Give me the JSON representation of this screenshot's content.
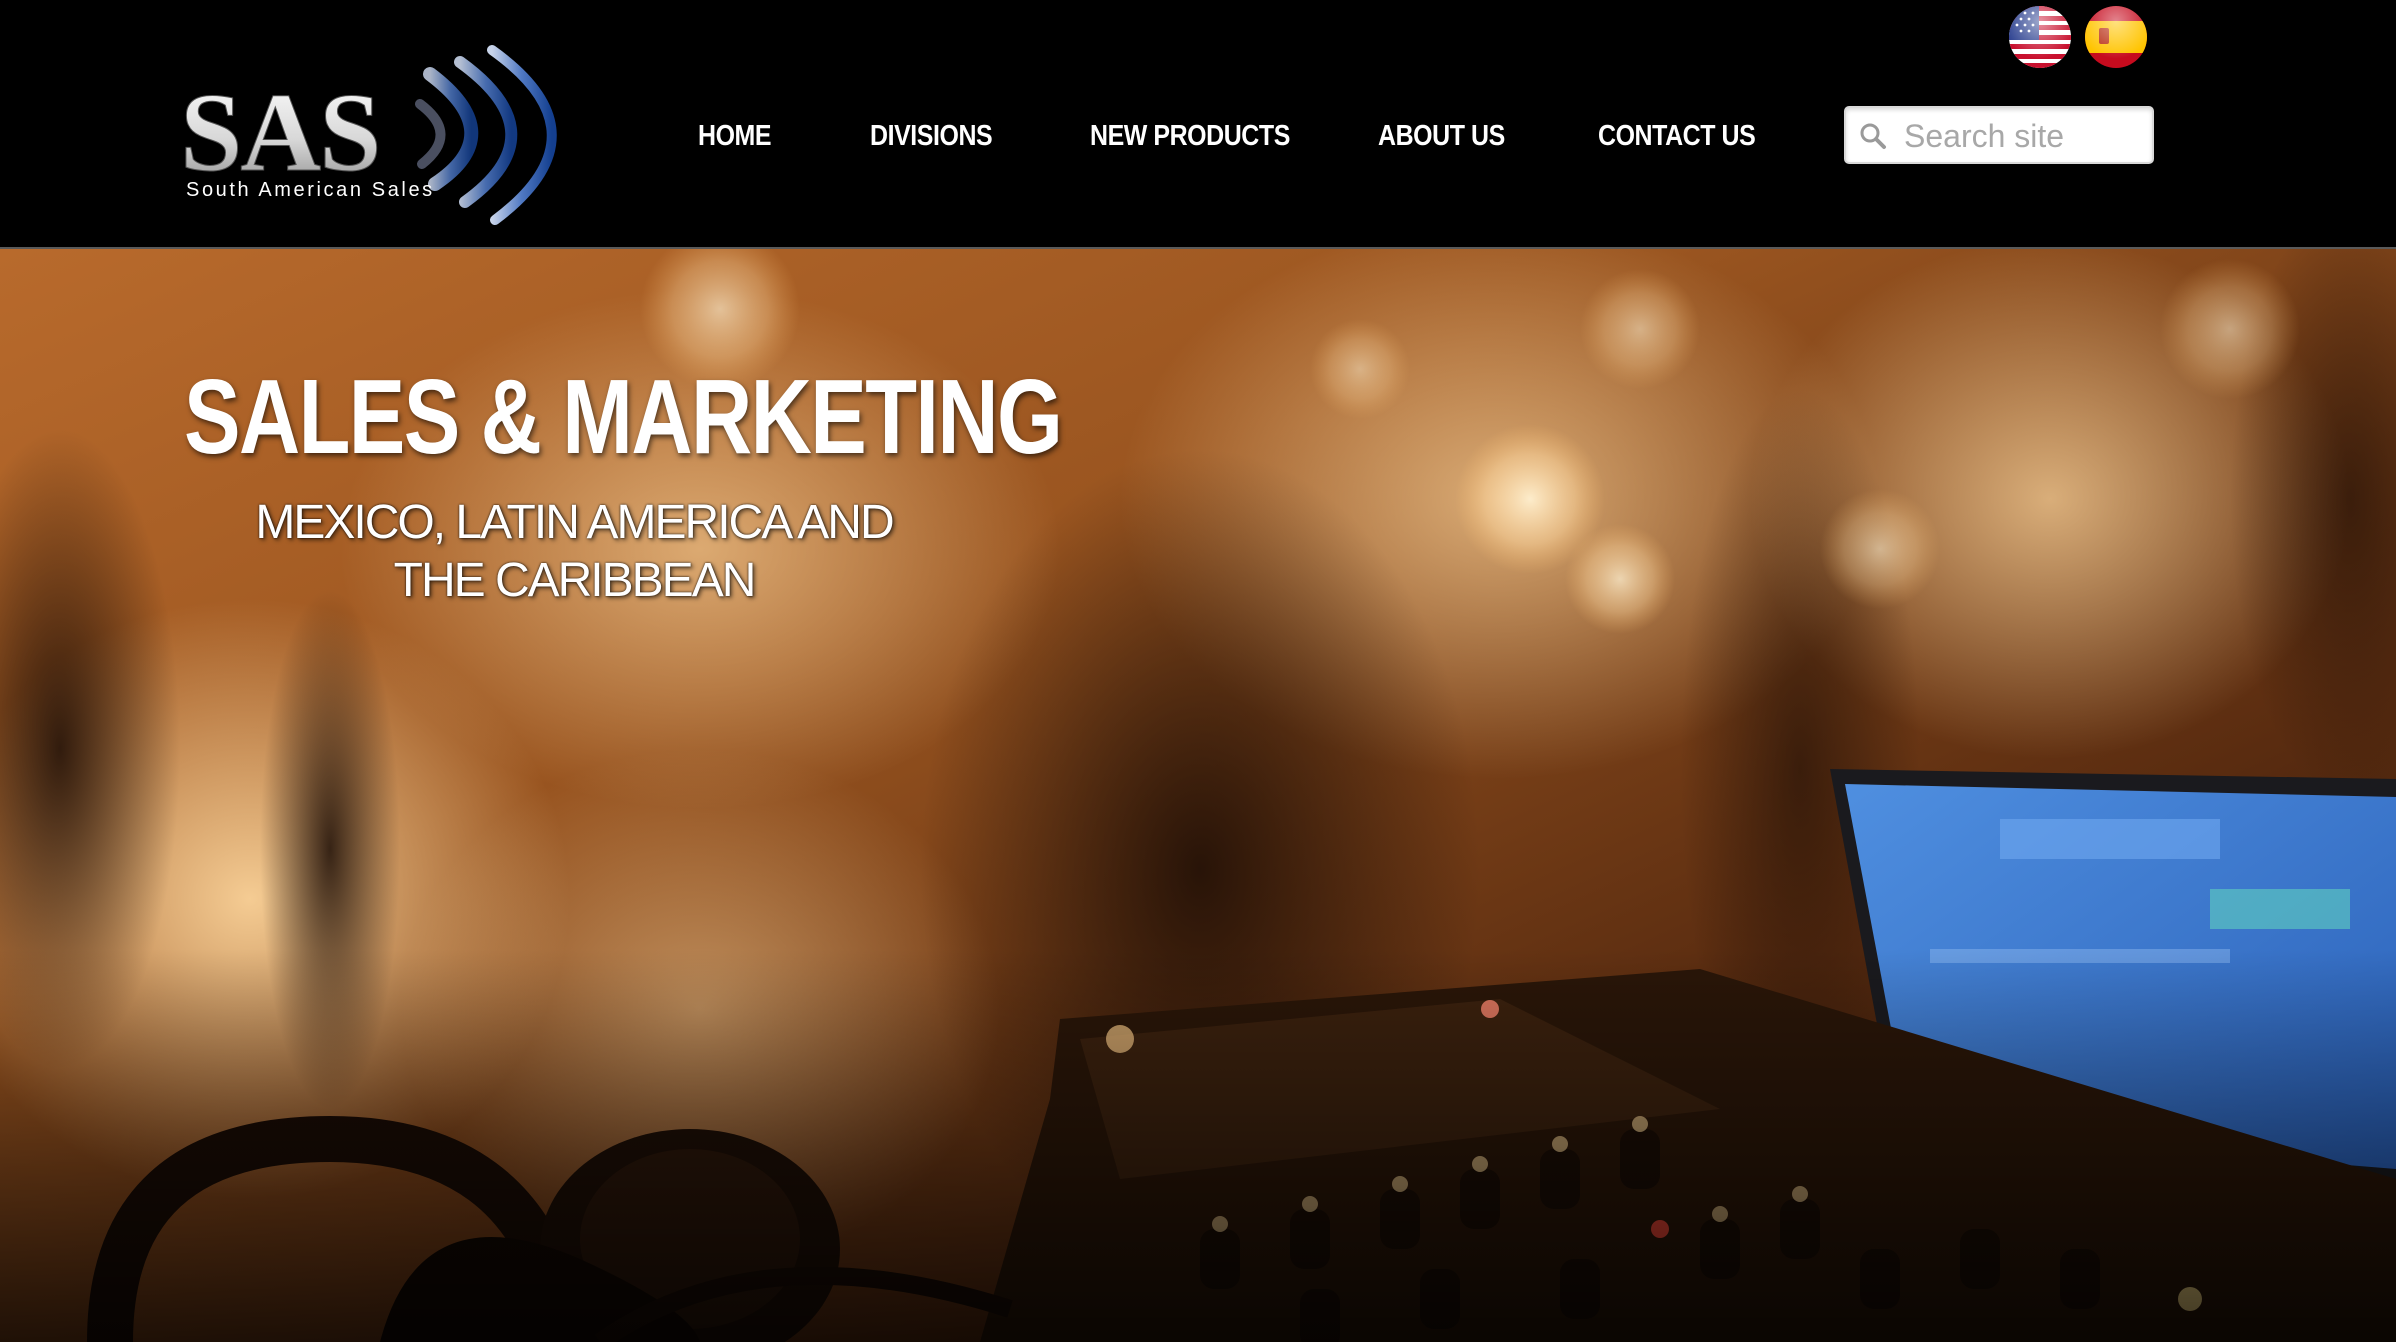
{
  "brand": {
    "logo_text": "SAS",
    "logo_tagline": "South American Sales"
  },
  "nav": {
    "items": [
      {
        "label": "HOME"
      },
      {
        "label": "DIVISIONS"
      },
      {
        "label": "NEW PRODUCTS"
      },
      {
        "label": "ABOUT US"
      },
      {
        "label": "CONTACT US"
      }
    ]
  },
  "search": {
    "placeholder": "Search site",
    "value": "",
    "icon": "search-icon"
  },
  "language": {
    "options": [
      {
        "icon": "us-flag-icon"
      },
      {
        "icon": "spain-flag-icon"
      }
    ]
  },
  "hero": {
    "title": "SALES & MARKETING",
    "subtitle_line1": "MEXICO, LATIN AMERICA AND",
    "subtitle_line2": "THE CARIBBEAN"
  },
  "colors": {
    "header_bg": "#000000",
    "nav_text": "#ffffff",
    "logo_arc_blue": "#1d4fa0",
    "hero_warm": "#c9803a"
  }
}
